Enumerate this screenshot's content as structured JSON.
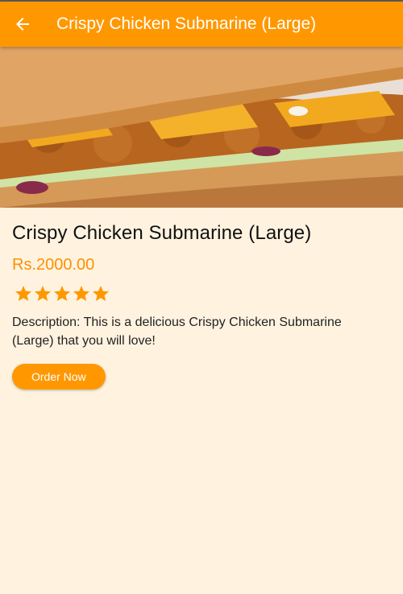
{
  "app_bar": {
    "title": "Crispy Chicken Submarine (Large)",
    "back_icon": "arrow-back-icon"
  },
  "product": {
    "image_alt": "Crispy Chicken Submarine sandwich",
    "title": "Crispy Chicken Submarine (Large)",
    "price": "Rs.2000.00",
    "rating": 5,
    "rating_max": 5,
    "description": "Description: This is a delicious Crispy Chicken Submarine (Large) that you will love!",
    "order_button_label": "Order Now"
  },
  "colors": {
    "primary": "#FF9800",
    "background": "#FFF3E0",
    "price": "#FF8F00",
    "star": "#FF9800"
  }
}
